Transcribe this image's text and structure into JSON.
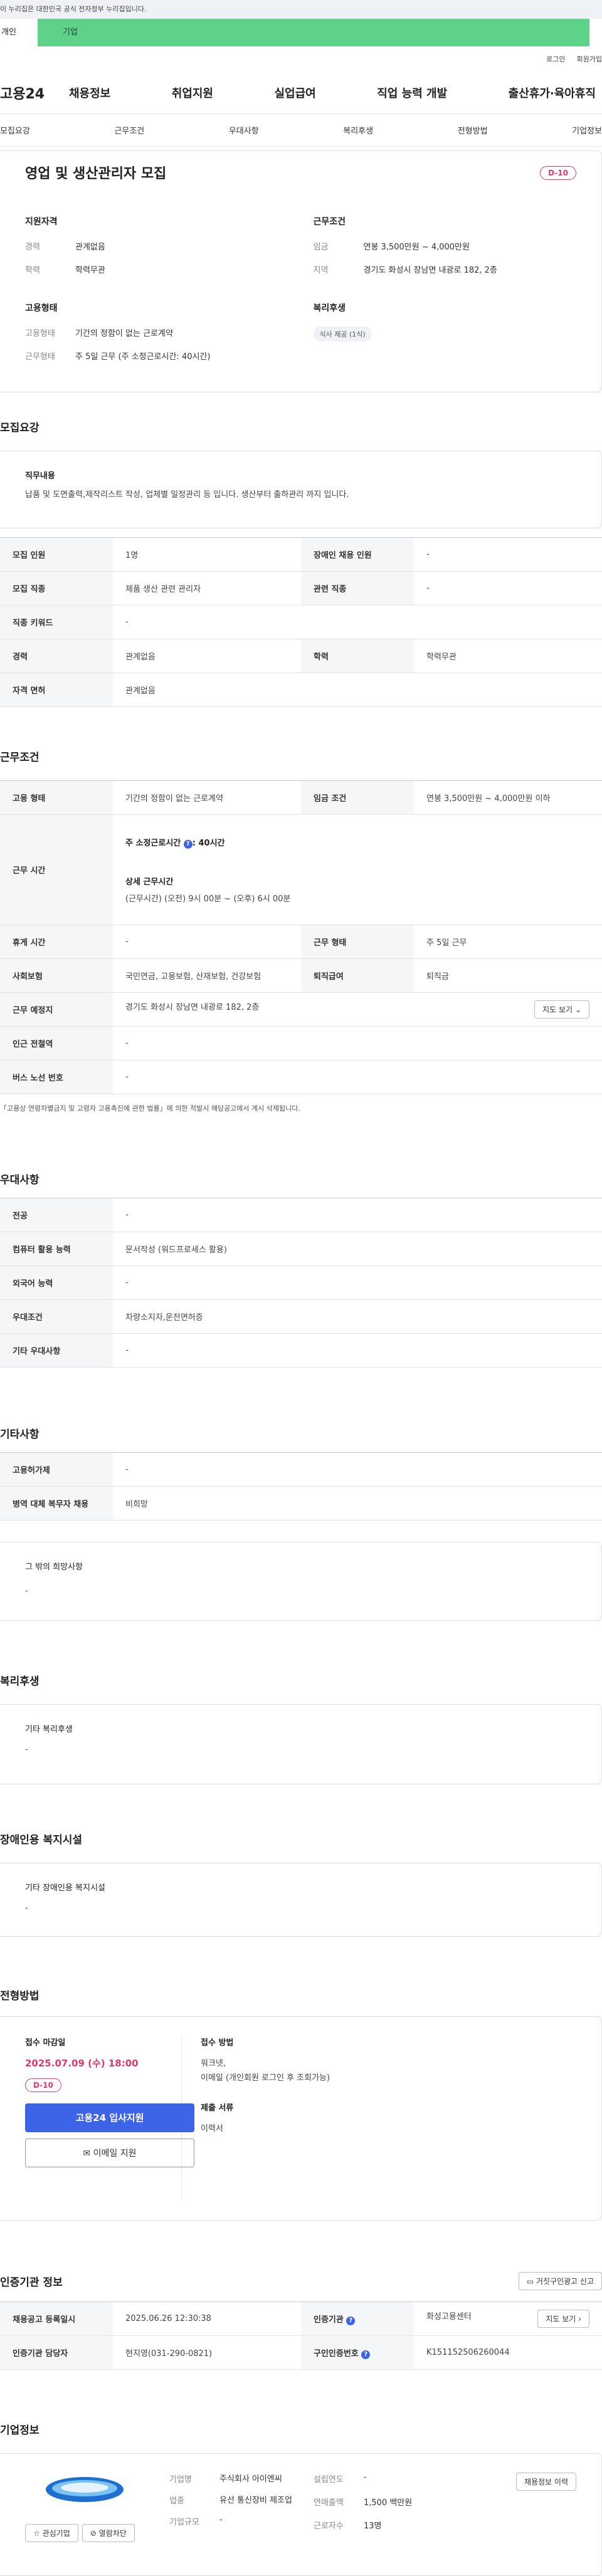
{
  "gov_banner": "이 누리집은 대한민국 공식 전자정부 누리집입니다.",
  "switch": {
    "personal": "개인",
    "company": "기업"
  },
  "util": {
    "login": "로그인",
    "join": "회원가입"
  },
  "logo": "고용24",
  "gnb": [
    "채용정보",
    "취업지원",
    "실업급여",
    "직업 능력 개발",
    "출산휴가·육아휴직"
  ],
  "tabs": [
    "모집요강",
    "근무조건",
    "우대사항",
    "복리후생",
    "전형방법",
    "기업정보"
  ],
  "summary": {
    "title": "영업 및 생산관리자 모집",
    "dday": "D-10",
    "qualification": {
      "heading": "지원자격",
      "items": [
        {
          "k": "경력",
          "v": "관계없음"
        },
        {
          "k": "학력",
          "v": "학력무관"
        }
      ]
    },
    "conditions": {
      "heading": "근무조건",
      "items": [
        {
          "k": "임금",
          "v": "연봉 3,500만원 ~ 4,000만원"
        },
        {
          "k": "지역",
          "v": "경기도 화성시 장남면 내광로 182, 2층"
        }
      ]
    },
    "employment": {
      "heading": "고용형태",
      "items": [
        {
          "k": "고용형태",
          "v": "기간의 정함이 없는 근로계약"
        },
        {
          "k": "근무형태",
          "v": "주 5일 근무 (주 소정근로시간: 40시간)"
        }
      ]
    },
    "welfare": {
      "heading": "복리후생",
      "chip": "식사 제공 (1식)"
    }
  },
  "recruit": {
    "heading": "모집요강",
    "job_title": "직무내용",
    "job_desc": "납품 및 도면출력,제작리스트 작성, 업체별 일정관리 등 입니다. 생산부터 출하관리 까지 입니다.",
    "rows": [
      [
        "모집 인원",
        "1명",
        "장애인 채용 인원",
        "-"
      ],
      [
        "모집 직종",
        "제품 생산 관련 관리자",
        "관련 직종",
        "-"
      ],
      [
        "직종 키워드",
        "-"
      ],
      [
        "경력",
        "관계없음",
        "학력",
        "학력무관"
      ],
      [
        "자격 면허",
        "관계없음"
      ]
    ]
  },
  "work": {
    "heading": "근무조건",
    "type_label": "고용 형태",
    "type_value": "기간의 정함이 없는 근로계약",
    "wage_label": "임금 조건",
    "wage_value": "연봉 3,500만원 ~ 4,000만원 이하",
    "hours_label": "근무 시간",
    "hours_week": "주 소정근로시간",
    "hours_week_value": ": 40시간",
    "hours_detail_title": "상세 근무시간",
    "hours_detail": "(근무시간) (오전) 9시 00분 ~ (오후) 6시 00분",
    "break_label": "휴게 시간",
    "break_value": "-",
    "form_label": "근무 형태",
    "form_value": "주 5일 근무",
    "insurance_label": "사회보험",
    "insurance_value": "국민연금, 고용보험, 산재보험, 건강보험",
    "retire_label": "퇴직급여",
    "retire_value": "퇴직금",
    "place_label": "근무 예정지",
    "place_value": "경기도 화성시 장남면 내광로 182, 2층",
    "map_btn": "지도 보기",
    "station_label": "인근 전철역",
    "station_value": "-",
    "bus_label": "버스 노선 번호",
    "bus_value": "-",
    "note": "「고용상 연령차별금지 및 고령자 고용촉진에 관한 법률」에 의한 적발시 해당공고에서 게시 삭제됩니다."
  },
  "preference": {
    "heading": "우대사항",
    "rows": [
      [
        "전공",
        "-"
      ],
      [
        "컴퓨터 활용 능력",
        "문서작성 (워드프로세스 활용)"
      ],
      [
        "외국어 능력",
        "-"
      ],
      [
        "우대조건",
        "차량소지자,운전면허증"
      ],
      [
        "기타 우대사항",
        "-"
      ]
    ]
  },
  "etc": {
    "heading": "기타사항",
    "rows": [
      [
        "고용허가제",
        "-"
      ],
      [
        "병역 대체 복무자 채용",
        "비희망"
      ]
    ],
    "box_title": "그 밖의 희망사항",
    "box_value": "-"
  },
  "welfare": {
    "heading": "복리후생",
    "box_title": "기타 복리후생",
    "box_value": "-"
  },
  "disability": {
    "heading": "장애인용 복지시설",
    "box_title": "기타 장애인용 복지시설",
    "box_value": "-"
  },
  "process": {
    "heading": "전형방법",
    "deadline_label": "접수 마감일",
    "deadline": "2025.07.09 (수) 18:00",
    "dday": "D-10",
    "apply_btn": "고용24 입사지원",
    "email_btn": "이메일 지원",
    "method_label": "접수 방법",
    "method_value": "워크넷,\n이메일 (개인회원 로그인 후 조회가능)",
    "docs_label": "제출 서류",
    "docs_value": "이력서"
  },
  "cert": {
    "heading": "인증기관 정보",
    "report_btn": "거짓구인광고 신고",
    "reg_label": "채용공고 등록일시",
    "reg_value": "2025.06.26 12:30:38",
    "org_label": "인증기관",
    "org_value": "화성고용센터",
    "manager_label": "인증기관 담당자",
    "manager_value": "현지영(031-290-0821)",
    "cert_label": "구인인증번호",
    "cert_value": "K151152506260044"
  },
  "company": {
    "heading": "기업정보",
    "fav_btn": "관심기업",
    "block_btn": "열람차단",
    "name_label": "기업명",
    "name_value": "주식회사 아이엔씨",
    "industry_label": "업종",
    "industry_value": "유선 통신장비 제조업",
    "scale_label": "기업규모",
    "scale_value": "-",
    "year_label": "설립연도",
    "year_value": "-",
    "sales_label": "연매출액",
    "sales_value": "1,500 백만원",
    "workers_label": "근로자수",
    "workers_value": "13명",
    "history_btn": "채용정보 이력"
  },
  "colors": {
    "accent": "#3d63e6",
    "dday": "#e3366d",
    "switch": "#5fd28a"
  }
}
